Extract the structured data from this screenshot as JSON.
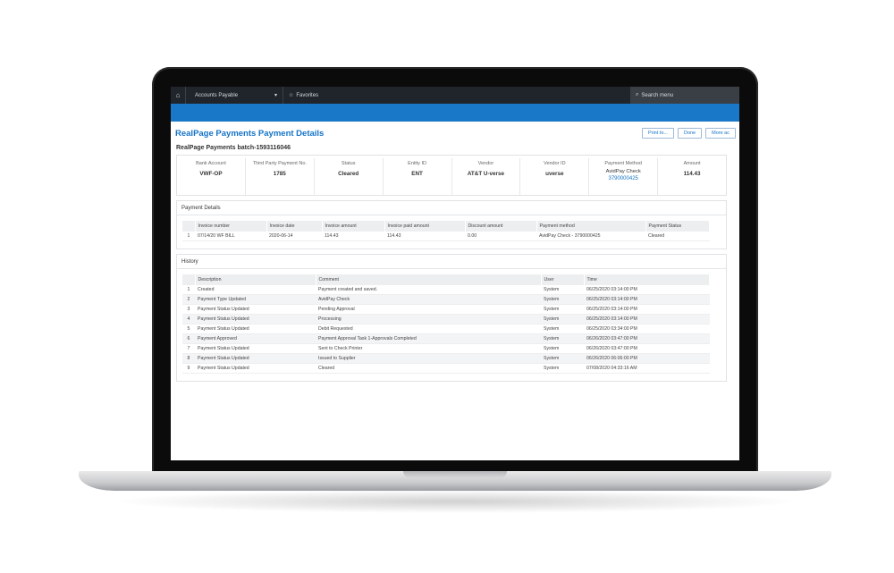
{
  "topbar": {
    "module": "Accounts Payable",
    "favorites": "Favorites",
    "search_placeholder": "Search menu"
  },
  "page": {
    "title": "RealPage Payments Payment Details",
    "batch": "RealPage Payments batch-1593116046"
  },
  "actions": {
    "print": "Print to...",
    "done": "Done",
    "more": "More ac"
  },
  "summary": {
    "bank_account": {
      "label": "Bank Account",
      "value": "VWF-OP"
    },
    "third_party_payment": {
      "label": "Third Party Payment No.",
      "value": "1785"
    },
    "status": {
      "label": "Status",
      "value": "Cleared"
    },
    "entity_id": {
      "label": "Entity ID",
      "value": "ENT"
    },
    "vendor": {
      "label": "Vendor",
      "value": "AT&T U-verse"
    },
    "vendor_id": {
      "label": "Vendor ID",
      "value": "uverse"
    },
    "payment_method": {
      "label": "Payment Method",
      "value": "AvidPay Check",
      "link": "3790000425"
    },
    "amount": {
      "label": "Amount",
      "value": "114.43"
    }
  },
  "payment_details": {
    "title": "Payment Details",
    "columns": [
      "",
      "Invoice number",
      "Invoice date",
      "Invoice amount",
      "Invoice paid amount",
      "Discount amount",
      "Payment method",
      "Payment Status"
    ],
    "row": [
      "1",
      "07/14/20 WF BILL",
      "2020-06-14",
      "114.43",
      "114.43",
      "0.00",
      "AvidPay Check - 3790000425",
      "Cleared"
    ]
  },
  "history": {
    "title": "History",
    "columns": [
      "",
      "Description",
      "Comment",
      "User",
      "Time"
    ],
    "rows": [
      [
        "1",
        "Created",
        "Payment created and saved.",
        "System",
        "06/25/2020 03:14:00 PM"
      ],
      [
        "2",
        "Payment Type Updated",
        "AvidPay Check",
        "System",
        "06/25/2020 03:14:00 PM"
      ],
      [
        "3",
        "Payment Status Updated",
        "Pending Approval",
        "System",
        "06/25/2020 03:14:00 PM"
      ],
      [
        "4",
        "Payment Status Updated",
        "Processing",
        "System",
        "06/25/2020 03:14:00 PM"
      ],
      [
        "5",
        "Payment Status Updated",
        "Debit Requested",
        "System",
        "06/25/2020 03:34:00 PM"
      ],
      [
        "6",
        "Payment Approved",
        "Payment Approval Task 1-Approvals Completed",
        "System",
        "06/26/2020 03:47:00 PM"
      ],
      [
        "7",
        "Payment Status Updated",
        "Sent to Check Printer",
        "System",
        "06/26/2020 03:47:00 PM"
      ],
      [
        "8",
        "Payment Status Updated",
        "Issued to Supplier",
        "System",
        "06/26/2020 06:06:00 PM"
      ],
      [
        "9",
        "Payment Status Updated",
        "Cleared",
        "System",
        "07/08/2020 04:33:16 AM"
      ]
    ]
  }
}
